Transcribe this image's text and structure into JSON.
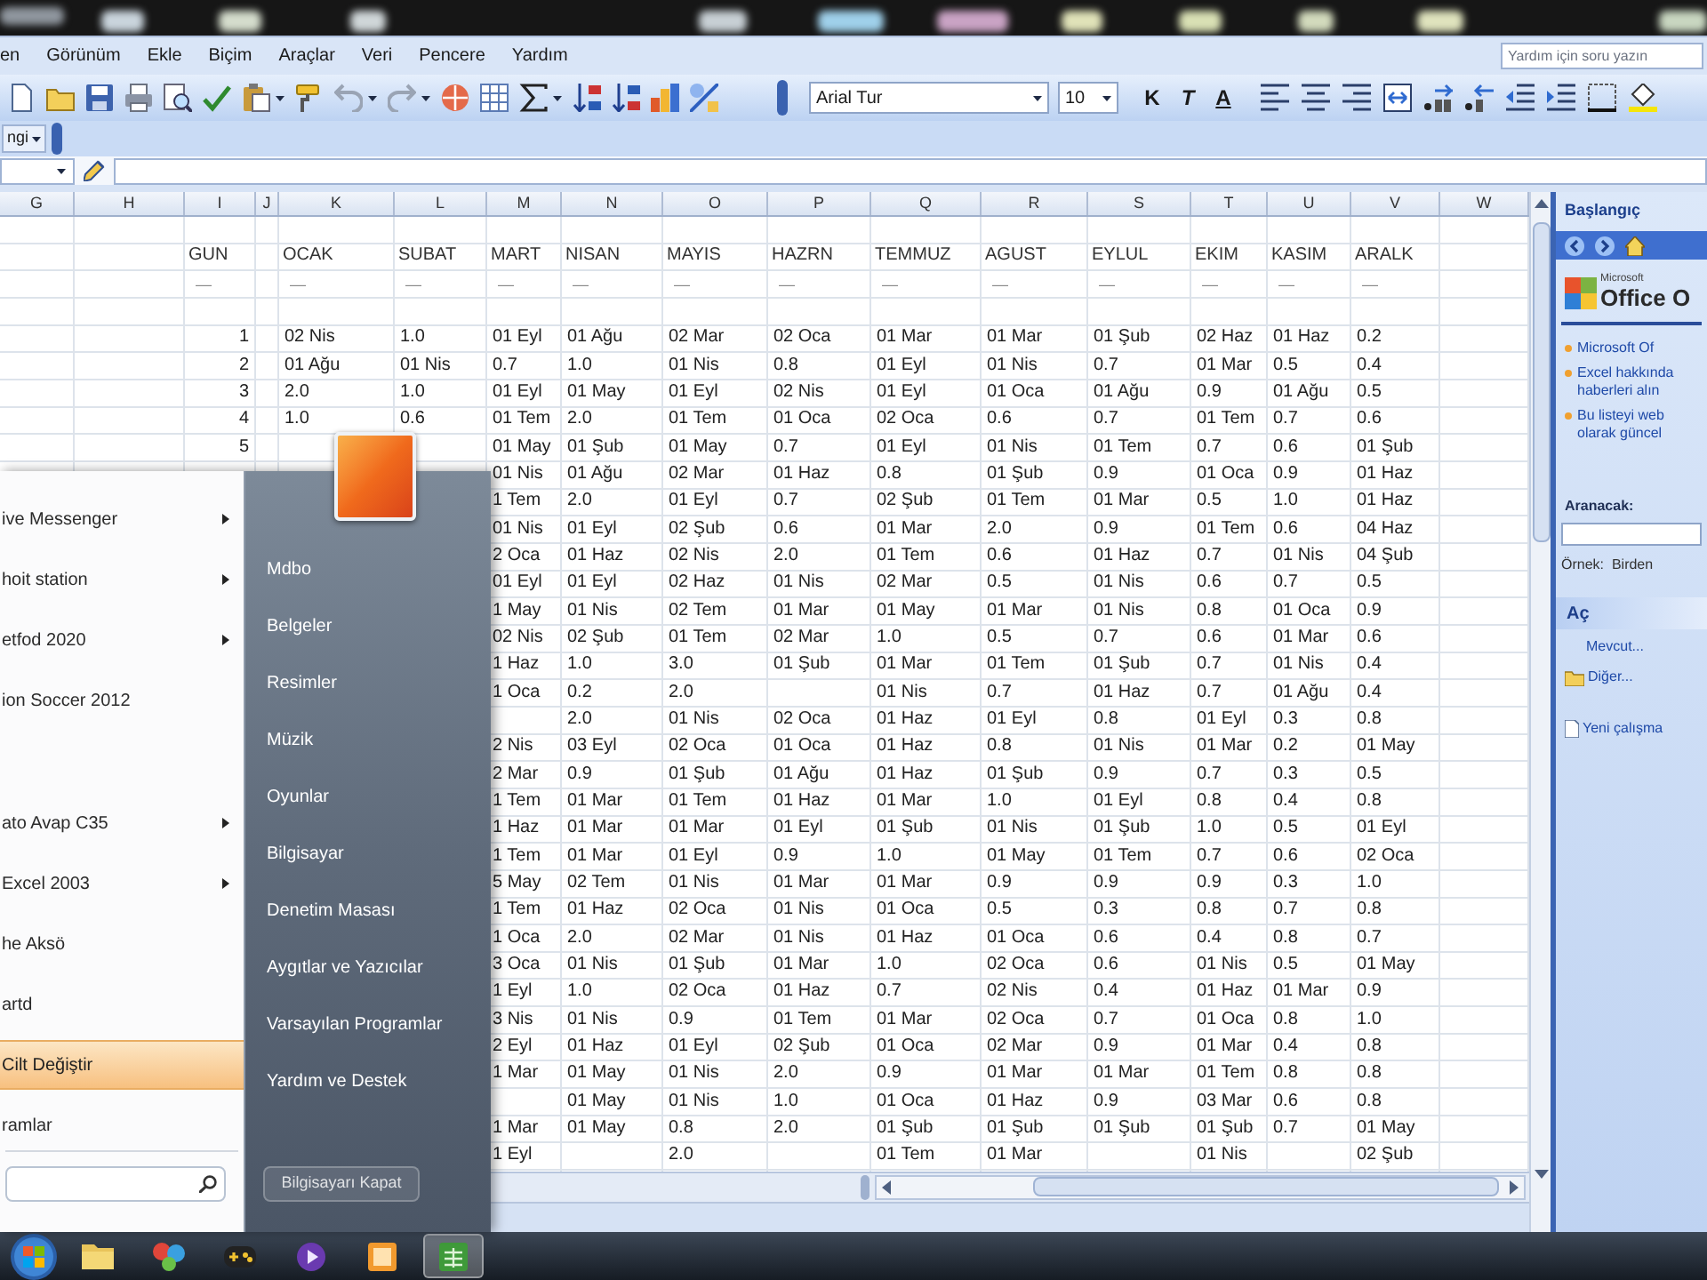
{
  "menu_bar": {
    "items": [
      "en",
      "Görünüm",
      "Ekle",
      "Biçim",
      "Araçlar",
      "Veri",
      "Pencere",
      "Yardım"
    ],
    "help_field": {
      "placeholder": "Yardım için soru yazın"
    }
  },
  "formatting_toolbar": {
    "font": "Arial Tur",
    "size": "10",
    "format_buttons": [
      {
        "label": "K",
        "kind": "bold"
      },
      {
        "label": "T",
        "kind": "italic"
      },
      {
        "label": "A",
        "kind": "underline"
      }
    ]
  },
  "toolbar_dropdown": {
    "label": "ngi"
  },
  "sheet": {
    "columns": [
      "G",
      "H",
      "I",
      "J",
      "K",
      "L",
      "M",
      "N",
      "O",
      "P",
      "Q",
      "R",
      "S",
      "T",
      "U",
      "V",
      "W"
    ],
    "header_row": {
      "col_i": "GUN",
      "col_k": "OCAK",
      "col_l": "SUBAT",
      "col_m": "MART",
      "col_n": "NISAN",
      "col_o": "MAYIS",
      "col_p": "HAZRN",
      "col_q": "TEMMUZ",
      "col_r": "AGUST",
      "col_s": "EYLUL",
      "col_t": "EKIM",
      "col_u": "KASIM",
      "col_v": "ARALK"
    },
    "underline_row": {
      "col_i": "—",
      "col_k": "—",
      "col_l": "—",
      "col_m": "—",
      "col_n": "—",
      "col_o": "—",
      "col_p": "—",
      "col_q": "—",
      "col_r": "—",
      "col_s": "—",
      "col_t": "—",
      "col_u": "—",
      "col_v": "—"
    },
    "rows": [
      {
        "col_i": "1",
        "col_k": "02 Nis",
        "col_l": "1.0",
        "col_m": "01 Eyl",
        "col_n": "01 Ağu",
        "col_o": "02 Mar",
        "col_p": "02 Oca",
        "col_q": "01 Mar",
        "col_r": "01 Mar",
        "col_s": "01 Şub",
        "col_t": "02 Haz",
        "col_u": "01 Haz",
        "col_v": "0.2"
      },
      {
        "col_i": "2",
        "col_k": "01 Ağu",
        "col_l": "01 Nis",
        "col_m": "0.7",
        "col_n": "1.0",
        "col_o": "01 Nis",
        "col_p": "0.8",
        "col_q": "01 Eyl",
        "col_r": "01 Nis",
        "col_s": "0.7",
        "col_t": "01 Mar",
        "col_u": "0.5",
        "col_v": "0.4"
      },
      {
        "col_i": "3",
        "col_k": "2.0",
        "col_l": "1.0",
        "col_m": "01 Eyl",
        "col_n": "01 May",
        "col_o": "01 Eyl",
        "col_p": "02 Nis",
        "col_q": "01 Eyl",
        "col_r": "01 Oca",
        "col_s": "01 Ağu",
        "col_t": "0.9",
        "col_u": "01 Ağu",
        "col_v": "0.5"
      },
      {
        "col_i": "4",
        "col_k": "1.0",
        "col_l": "0.6",
        "col_m": "01 Tem",
        "col_n": "2.0",
        "col_o": "01 Tem",
        "col_p": "01 Oca",
        "col_q": "02 Oca",
        "col_r": "0.6",
        "col_s": "0.7",
        "col_t": "01 Tem",
        "col_u": "0.7",
        "col_v": "0.6"
      },
      {
        "col_i": "5",
        "col_m": "01 May",
        "col_n": "01 Şub",
        "col_o": "01 May",
        "col_p": "0.7",
        "col_q": "01 Eyl",
        "col_r": "01 Nis",
        "col_s": "01 Tem",
        "col_t": "0.7",
        "col_u": "0.6",
        "col_v": "01 Şub"
      },
      {
        "col_m": "01 Nis",
        "col_n": "01 Ağu",
        "col_o": "02 Mar",
        "col_p": "01 Haz",
        "col_q": "0.8",
        "col_r": "01 Şub",
        "col_s": "0.9",
        "col_t": "01 Oca",
        "col_u": "0.9",
        "col_v": "01 Haz"
      },
      {
        "col_m": "1 Tem",
        "col_n": "2.0",
        "col_o": "01 Eyl",
        "col_p": "0.7",
        "col_q": "02 Şub",
        "col_r": "01 Tem",
        "col_s": "01 Mar",
        "col_t": "0.5",
        "col_u": "1.0",
        "col_v": "01 Haz"
      },
      {
        "col_m": "01 Nis",
        "col_n": "01 Eyl",
        "col_o": "02 Şub",
        "col_p": "0.6",
        "col_q": "01 Mar",
        "col_r": "2.0",
        "col_s": "0.9",
        "col_t": "01 Tem",
        "col_u": "0.6",
        "col_v": "04 Haz"
      },
      {
        "col_m": "2 Oca",
        "col_n": "01 Haz",
        "col_o": "02 Nis",
        "col_p": "2.0",
        "col_q": "01 Tem",
        "col_r": "0.6",
        "col_s": "01 Haz",
        "col_t": "0.7",
        "col_u": "01 Nis",
        "col_v": "04 Şub"
      },
      {
        "col_m": "01 Eyl",
        "col_n": "01 Eyl",
        "col_o": "02 Haz",
        "col_p": "01 Nis",
        "col_q": "02 Mar",
        "col_r": "0.5",
        "col_s": "01 Nis",
        "col_t": "0.6",
        "col_u": "0.7",
        "col_v": "0.5"
      },
      {
        "col_m": "1 May",
        "col_n": "01 Nis",
        "col_o": "02 Tem",
        "col_p": "01 Mar",
        "col_q": "01 May",
        "col_r": "01 Mar",
        "col_s": "01 Nis",
        "col_t": "0.8",
        "col_u": "01 Oca",
        "col_v": "0.9"
      },
      {
        "col_m": "02 Nis",
        "col_n": "02 Şub",
        "col_o": "01 Tem",
        "col_p": "02 Mar",
        "col_q": "1.0",
        "col_r": "0.5",
        "col_s": "0.7",
        "col_t": "0.6",
        "col_u": "01 Mar",
        "col_v": "0.6"
      },
      {
        "col_m": "1 Haz",
        "col_n": "1.0",
        "col_o": "3.0",
        "col_p": "01 Şub",
        "col_q": "01 Mar",
        "col_r": "01 Tem",
        "col_s": "01 Şub",
        "col_t": "0.7",
        "col_u": "01 Nis",
        "col_v": "0.4"
      },
      {
        "col_m": "1 Oca",
        "col_n": "0.2",
        "col_o": "2.0",
        "col_q": "01 Nis",
        "col_r": "0.7",
        "col_s": "01 Haz",
        "col_t": "0.7",
        "col_u": "01 Ağu",
        "col_v": "0.4"
      },
      {
        "col_n": "2.0",
        "col_o": "01 Nis",
        "col_p": "02 Oca",
        "col_q": "01 Haz",
        "col_r": "01 Eyl",
        "col_s": "0.8",
        "col_t": "01 Eyl",
        "col_u": "0.3",
        "col_v": "0.8"
      },
      {
        "col_m": "2 Nis",
        "col_n": "03 Eyl",
        "col_o": "02 Oca",
        "col_p": "01 Oca",
        "col_q": "01 Haz",
        "col_r": "0.8",
        "col_s": "01 Nis",
        "col_t": "01 Mar",
        "col_u": "0.2",
        "col_v": "01 May"
      },
      {
        "col_m": "2 Mar",
        "col_n": "0.9",
        "col_o": "01 Şub",
        "col_p": "01 Ağu",
        "col_q": "01 Haz",
        "col_r": "01 Şub",
        "col_s": "0.9",
        "col_t": "0.7",
        "col_u": "0.3",
        "col_v": "0.5"
      },
      {
        "col_m": "1 Tem",
        "col_n": "01 Mar",
        "col_o": "01 Tem",
        "col_p": "01 Haz",
        "col_q": "01 Mar",
        "col_r": "1.0",
        "col_s": "01 Eyl",
        "col_t": "0.8",
        "col_u": "0.4",
        "col_v": "0.8"
      },
      {
        "col_m": "1 Haz",
        "col_n": "01 Mar",
        "col_o": "01 Mar",
        "col_p": "01 Eyl",
        "col_q": "01 Şub",
        "col_r": "01 Nis",
        "col_s": "01 Şub",
        "col_t": "1.0",
        "col_u": "0.5",
        "col_v": "01 Eyl"
      },
      {
        "col_m": "1 Tem",
        "col_n": "01 Mar",
        "col_o": "01 Eyl",
        "col_p": "0.9",
        "col_q": "1.0",
        "col_r": "01 May",
        "col_s": "01 Tem",
        "col_t": "0.7",
        "col_u": "0.6",
        "col_v": "02 Oca"
      },
      {
        "col_m": "5 May",
        "col_n": "02 Tem",
        "col_o": "01 Nis",
        "col_p": "01 Mar",
        "col_q": "01 Mar",
        "col_r": "0.9",
        "col_s": "0.9",
        "col_t": "0.9",
        "col_u": "0.3",
        "col_v": "1.0"
      },
      {
        "col_m": "1 Tem",
        "col_n": "01 Haz",
        "col_o": "02 Oca",
        "col_p": "01 Nis",
        "col_q": "01 Oca",
        "col_r": "0.5",
        "col_s": "0.3",
        "col_t": "0.8",
        "col_u": "0.7",
        "col_v": "0.8"
      },
      {
        "col_m": "1 Oca",
        "col_n": "2.0",
        "col_o": "02 Mar",
        "col_p": "01 Nis",
        "col_q": "01 Haz",
        "col_r": "01 Oca",
        "col_s": "0.6",
        "col_t": "0.4",
        "col_u": "0.8",
        "col_v": "0.7"
      },
      {
        "col_m": "3 Oca",
        "col_n": "01 Nis",
        "col_o": "01 Şub",
        "col_p": "01 Mar",
        "col_q": "1.0",
        "col_r": "02 Oca",
        "col_s": "0.6",
        "col_t": "01 Nis",
        "col_u": "0.5",
        "col_v": "01 May"
      },
      {
        "col_m": "1 Eyl",
        "col_n": "1.0",
        "col_o": "02 Oca",
        "col_p": "01 Haz",
        "col_q": "0.7",
        "col_r": "02 Nis",
        "col_s": "0.4",
        "col_t": "01 Haz",
        "col_u": "01 Mar",
        "col_v": "0.9"
      },
      {
        "col_m": "3 Nis",
        "col_n": "01 Nis",
        "col_o": "0.9",
        "col_p": "01 Tem",
        "col_q": "01 Mar",
        "col_r": "02 Oca",
        "col_s": "0.7",
        "col_t": "01 Oca",
        "col_u": "0.8",
        "col_v": "1.0"
      },
      {
        "col_m": "2 Eyl",
        "col_n": "01 Haz",
        "col_o": "01 Eyl",
        "col_p": "02 Şub",
        "col_q": "01 Oca",
        "col_r": "02 Mar",
        "col_s": "0.9",
        "col_t": "01 Mar",
        "col_u": "0.4",
        "col_v": "0.8"
      },
      {
        "col_m": "1 Mar",
        "col_n": "01 May",
        "col_o": "01 Nis",
        "col_p": "2.0",
        "col_q": "0.9",
        "col_r": "01 Mar",
        "col_s": "01 Mar",
        "col_t": "01 Tem",
        "col_u": "0.8",
        "col_v": "0.8"
      },
      {
        "col_n": "01 May",
        "col_o": "01 Nis",
        "col_p": "1.0",
        "col_q": "01 Oca",
        "col_r": "01 Haz",
        "col_s": "0.9",
        "col_t": "03 Mar",
        "col_u": "0.6",
        "col_v": "0.8"
      },
      {
        "col_m": "1 Mar",
        "col_n": "01 May",
        "col_o": "0.8",
        "col_p": "2.0",
        "col_q": "01 Şub",
        "col_r": "01 Şub",
        "col_s": "01 Şub",
        "col_t": "01 Şub",
        "col_u": "0.7",
        "col_v": "01 May"
      },
      {
        "col_m": "1 Eyl",
        "col_o": "2.0",
        "col_q": "01 Tem",
        "col_r": "01 Mar",
        "col_t": "01 Nis",
        "col_v": "02 Şub"
      }
    ]
  },
  "task_pane": {
    "title": "Başlangıç",
    "logo_small": "Microsoft",
    "logo_text": "Office O",
    "bullets": [
      "Microsoft Of",
      "Excel hakkında haberleri alın",
      "Bu listeyi web olarak güncel"
    ],
    "search_label": "Aranacak:",
    "example": "Örnek:  Birden",
    "open_title": "Aç",
    "open_items": [
      {
        "label": "Mevcut...",
        "kind": "recent"
      },
      {
        "label": "Diğer...",
        "kind": "folder"
      },
      {
        "label": "Yeni çalışma",
        "kind": "new"
      }
    ]
  },
  "start_menu": {
    "programs": [
      {
        "label": "ive Messenger",
        "submenu": true,
        "selected": false
      },
      {
        "label": "hoit station",
        "submenu": true,
        "selected": false
      },
      {
        "label": "etfod 2020",
        "submenu": true,
        "selected": false
      },
      {
        "label": "ion Soccer 2012",
        "submenu": false,
        "selected": false
      },
      {
        "label": "ato Avap C35",
        "submenu": true,
        "selected": false
      },
      {
        "label": "Excel 2003",
        "submenu": true,
        "selected": false
      },
      {
        "label": "he Aksö",
        "submenu": false,
        "selected": false
      },
      {
        "label": "artd",
        "submenu": false,
        "selected": false
      },
      {
        "label": "Cilt Değiştir",
        "submenu": false,
        "selected": true
      },
      {
        "label": "ramlar",
        "submenu": false,
        "selected": false
      }
    ],
    "places": [
      "Mdbo",
      "Belgeler",
      "Resimler",
      "Müzik",
      "Oyunlar",
      "Bilgisayar",
      "Denetim Masası",
      "Aygıtlar ve Yazıcılar",
      "Varsayılan Programlar",
      "Yardım ve Destek"
    ],
    "shutdown": "Bilgisayarı Kapat"
  },
  "taskbar": {
    "apps": [
      {
        "kind": "folder",
        "selected": false
      },
      {
        "kind": "paint",
        "selected": false
      },
      {
        "kind": "game",
        "selected": false
      },
      {
        "kind": "media",
        "selected": false
      },
      {
        "kind": "photo",
        "selected": false
      },
      {
        "kind": "sheet",
        "selected": true
      }
    ]
  }
}
